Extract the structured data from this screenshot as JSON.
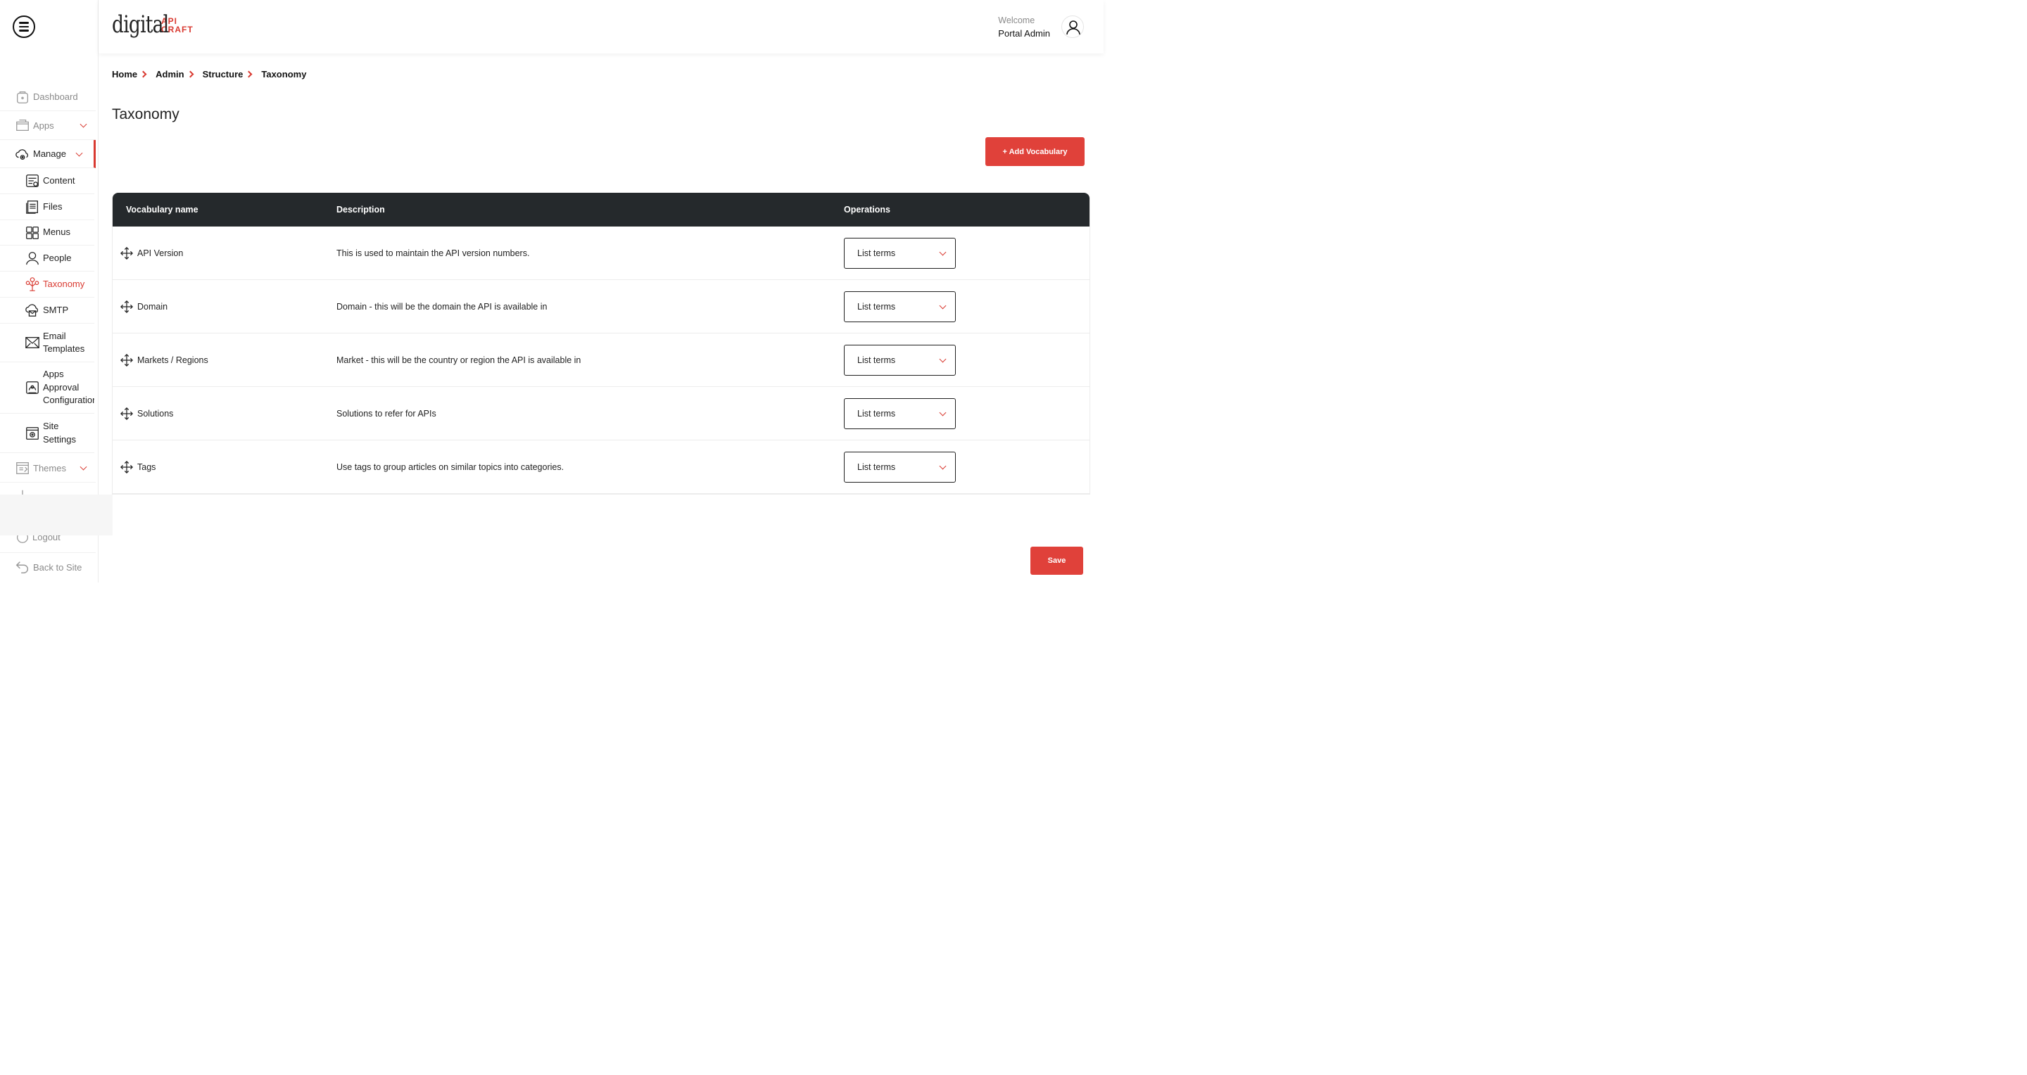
{
  "brand": {
    "logo_main": "digital",
    "logo_sub_1": "API",
    "logo_sub_2": "CRAFT",
    "accent": "#d93a31"
  },
  "user": {
    "welcome": "Welcome",
    "name": "Portal Admin"
  },
  "sidebar": {
    "items": [
      {
        "label": "Dashboard",
        "icon": "home-icon"
      },
      {
        "label": "Apps",
        "icon": "box-icon"
      },
      {
        "label": "Manage",
        "icon": "cloud-gear-icon"
      },
      {
        "label": "Themes",
        "icon": "palette-icon"
      },
      {
        "label": "Logout",
        "icon": "power-icon"
      },
      {
        "label": "Back to Site",
        "icon": "back-arrow-icon"
      }
    ],
    "sub_items": [
      {
        "label": "Content",
        "icon": "content-icon"
      },
      {
        "label": "Files",
        "icon": "files-icon"
      },
      {
        "label": "Menus",
        "icon": "grid-icon"
      },
      {
        "label": "People",
        "icon": "person-icon"
      },
      {
        "label": "Taxonomy",
        "icon": "tree-icon"
      },
      {
        "label": "SMTP",
        "icon": "cloud-mail-icon"
      },
      {
        "label": "Email Templates",
        "icon": "envelope-icon"
      },
      {
        "label": "Apps Approval Configuration",
        "icon": "approval-icon"
      },
      {
        "label": "Site Settings",
        "icon": "settings-icon"
      }
    ]
  },
  "breadcrumb": [
    "Home",
    "Admin",
    "Structure",
    "Taxonomy"
  ],
  "page": {
    "title": "Taxonomy",
    "add_button": "+ Add Vocabulary",
    "save_button": "Save"
  },
  "table": {
    "headers": {
      "name": "Vocabulary name",
      "description": "Description",
      "operations": "Operations"
    },
    "rows": [
      {
        "name": "API Version",
        "description": "This is used to maintain the API version numbers.",
        "operation": "List terms"
      },
      {
        "name": "Domain",
        "description": "Domain - this will be the domain the API is available in",
        "operation": "List terms"
      },
      {
        "name": "Markets / Regions",
        "description": "Market - this will be the country or region the API is available in",
        "operation": "List terms"
      },
      {
        "name": "Solutions",
        "description": "Solutions to refer for APIs",
        "operation": "List terms"
      },
      {
        "name": "Tags",
        "description": "Use tags to group articles on similar topics into categories.",
        "operation": "List terms"
      }
    ]
  }
}
